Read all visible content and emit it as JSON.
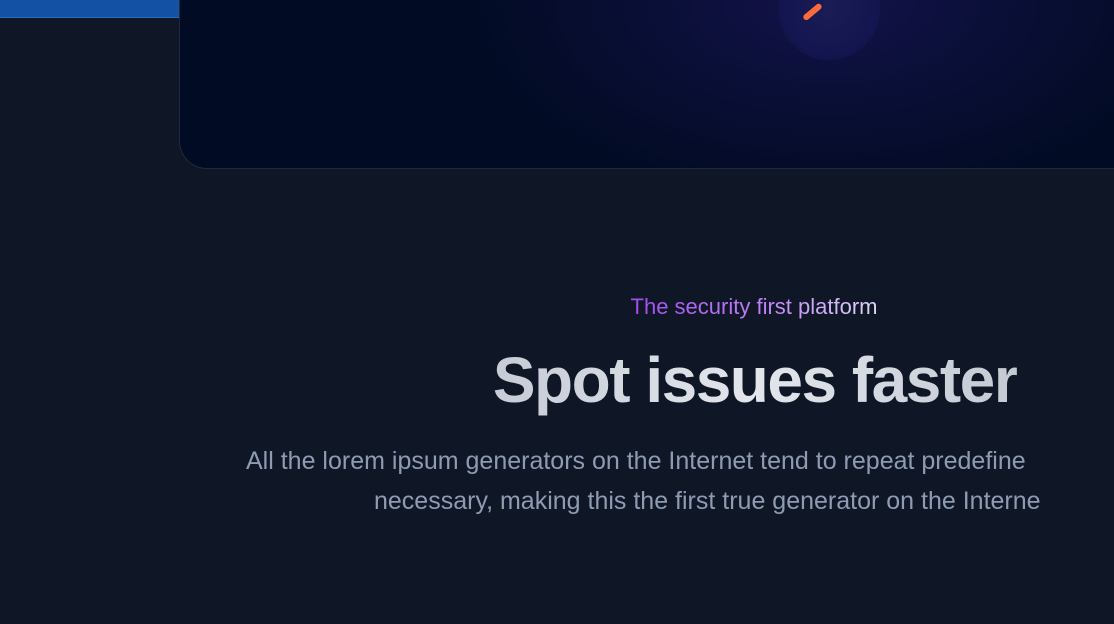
{
  "hero": {
    "eyebrow": "The security first platform",
    "title": "Spot issues faster",
    "description_line_1": "All the lorem ipsum generators on the Internet tend to repeat predefine",
    "description_line_2": "necessary, making this the first true generator on the Interne"
  },
  "colors": {
    "background": "#0f1727",
    "browser_bar": "#1251a3",
    "accent_purple": "#a24bf0",
    "title": "#e3e6ec",
    "body_text": "#8f9bb2",
    "mark": "#ff6a3d"
  },
  "icons": {
    "card_mark": "orange-stroke-icon"
  }
}
